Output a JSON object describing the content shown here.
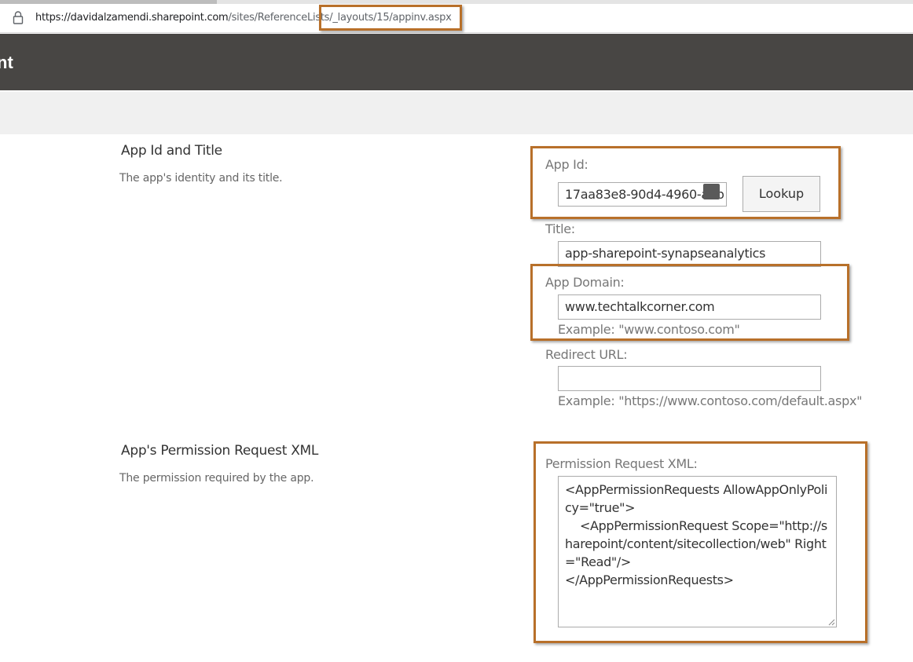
{
  "browser": {
    "url_host": "https://davidalzamendi.sharepoint.com",
    "url_path": "/sites/ReferenceLists/_layouts/15/appinv.aspx"
  },
  "suite": {
    "title_fragment": "nt"
  },
  "sections": {
    "app_id_title": {
      "heading": "App Id and Title",
      "description": "The app's identity and its title."
    },
    "permissions": {
      "heading": "App's Permission Request XML",
      "description": "The permission required by the app."
    }
  },
  "form": {
    "app_id_label": "App Id:",
    "app_id_value": "17aa83e8-90d4-4960-a6b",
    "lookup_label": "Lookup",
    "title_label": "Title:",
    "title_value": "app-sharepoint-synapseanalytics",
    "app_domain_label": "App Domain:",
    "app_domain_value": "www.techtalkcorner.com",
    "app_domain_example": "Example: \"www.contoso.com\"",
    "redirect_label": "Redirect URL:",
    "redirect_value": "",
    "redirect_example": "Example: \"https://www.contoso.com/default.aspx\"",
    "permission_label": "Permission Request XML:",
    "permission_value": "<AppPermissionRequests AllowAppOnlyPolicy=\"true\">\n    <AppPermissionRequest Scope=\"http://sharepoint/content/sitecollection/web\" Right=\"Read\"/>\n</AppPermissionRequests>"
  },
  "colors": {
    "annotation": "#b8702a",
    "suite_bar": "#484644",
    "command_bar": "#f0f0f0"
  }
}
